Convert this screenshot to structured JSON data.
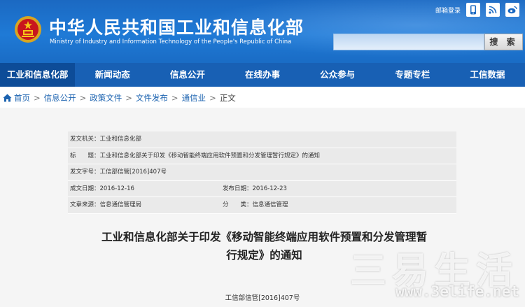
{
  "header": {
    "title": "中华人民共和国工业和信息化部",
    "subtitle": "Ministry of Industry and Information Technology of the People's Republic of China",
    "mail_login": "邮箱登录",
    "search_button": "搜 索"
  },
  "nav": {
    "items": [
      {
        "label": "工业和信息化部"
      },
      {
        "label": "新闻动态"
      },
      {
        "label": "信息公开"
      },
      {
        "label": "在线办事"
      },
      {
        "label": "公众参与"
      },
      {
        "label": "专题专栏"
      },
      {
        "label": "工信数据"
      }
    ]
  },
  "breadcrumb": {
    "items": [
      "首页",
      "信息公开",
      "政策文件",
      "文件发布",
      "通信业",
      "正文"
    ],
    "separator": ">"
  },
  "info": {
    "issuer": "发文机关：工业和信息化部",
    "title": "标　　题：工业和信息化部关于印发《移动智能终端应用软件预置和分发管理暂行规定》的通知",
    "doc_no": "发文字号：工信部信管[2016]407号",
    "created": "成文日期：2016-12-16",
    "published": "发布日期：2016-12-23",
    "source": "文章来源：信息通信管理局",
    "category": "分　　类：信息通信管理"
  },
  "document": {
    "title_line1": "工业和信息化部关于印发《移动智能终端应用软件预置和分发管理暂",
    "title_line2": "行规定》的通知",
    "number": "工信部信管[2016]407号"
  },
  "watermark": {
    "text_cn": "三易生活",
    "url": "www.3elife.net"
  }
}
